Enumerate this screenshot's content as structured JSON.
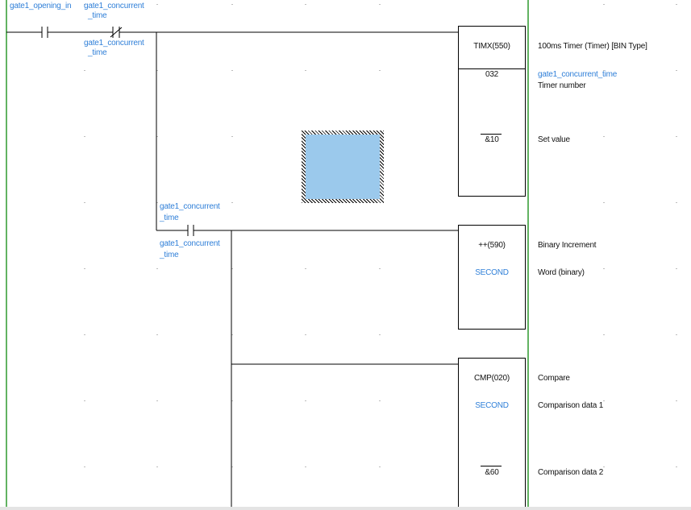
{
  "colors": {
    "wire": "#000000",
    "operand_blue": "#2f7fd8",
    "right_rail_green": "#2f9a2f",
    "grid_dot": "#bdbdbd",
    "selection_fill": "#9bc9ec"
  },
  "rung1": {
    "contact1_label": "gate1_opening_in",
    "contact2_label_line1": "gate1_concurrent",
    "contact2_label_line2": "_time",
    "branch_label_line1": "gate1_concurrent",
    "branch_label_line2": "_time",
    "timer": {
      "instruction": "TIMX(550)",
      "description": "100ms Timer (Timer) [BIN Type]",
      "operand1": "032",
      "operand1_name": "gate1_concurrent_time",
      "operand1_desc": "Timer number",
      "operand2": "&10",
      "operand2_desc": "Set value"
    }
  },
  "rung2": {
    "contact_label_line1": "gate1_concurrent",
    "contact_label_line2": "_time",
    "branch_label_line1": "gate1_concurrent",
    "branch_label_line2": "_time",
    "increment": {
      "instruction": "++(590)",
      "description": "Binary Increment",
      "operand1": "SECOND",
      "operand1_desc": "Word (binary)"
    }
  },
  "rung3": {
    "compare": {
      "instruction": "CMP(020)",
      "description": "Compare",
      "operand1": "SECOND",
      "operand1_desc": "Comparison data 1",
      "operand2": "&60",
      "operand2_desc": "Comparison data 2"
    }
  }
}
